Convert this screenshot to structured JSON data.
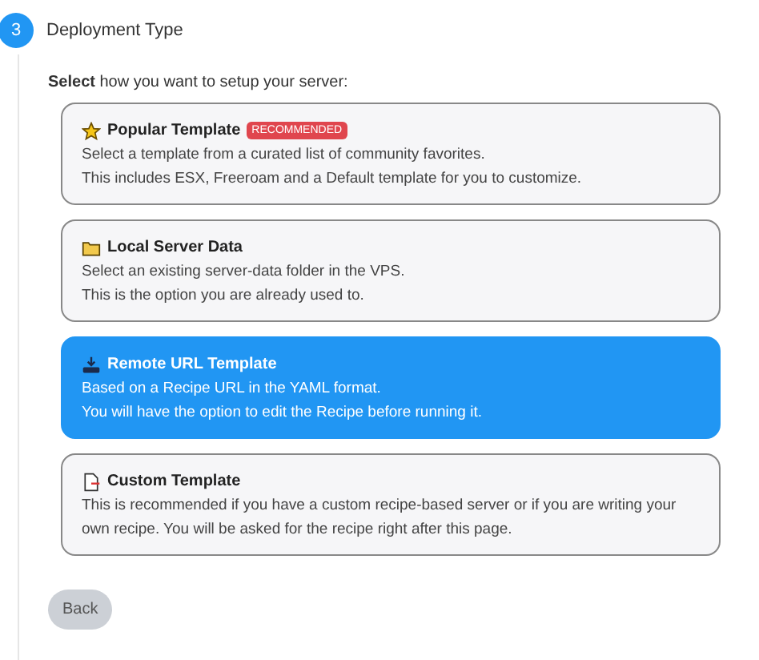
{
  "step": {
    "number": "3",
    "title": "Deployment Type"
  },
  "prompt": "**Select** how you want to setup your server:",
  "options": [
    {
      "kind": "star",
      "title": "Popular Template",
      "badge": "RECOMMENDED",
      "selected": false,
      "lines": [
        "Select a template from a curated list of community favorites.",
        "This includes ESX, Freeroam and a Default template for you to customize."
      ]
    },
    {
      "kind": "folder",
      "title": "Local Server Data",
      "selected": false,
      "lines": [
        "Select an existing server-data folder in the VPS.",
        "This is the option you are already used to."
      ]
    },
    {
      "kind": "download",
      "title": "Remote URL Template",
      "selected": true,
      "lines": [
        "Based on a Recipe URL in the YAML format.",
        "You will have the option to edit the Recipe before running it."
      ]
    },
    {
      "kind": "file",
      "title": "Custom Template",
      "selected": false,
      "lines": [
        "This is recommended if you have a custom recipe-based server or if you are writing your own recipe. You will be asked for the recipe right after this page."
      ]
    }
  ],
  "back_button": "Back"
}
